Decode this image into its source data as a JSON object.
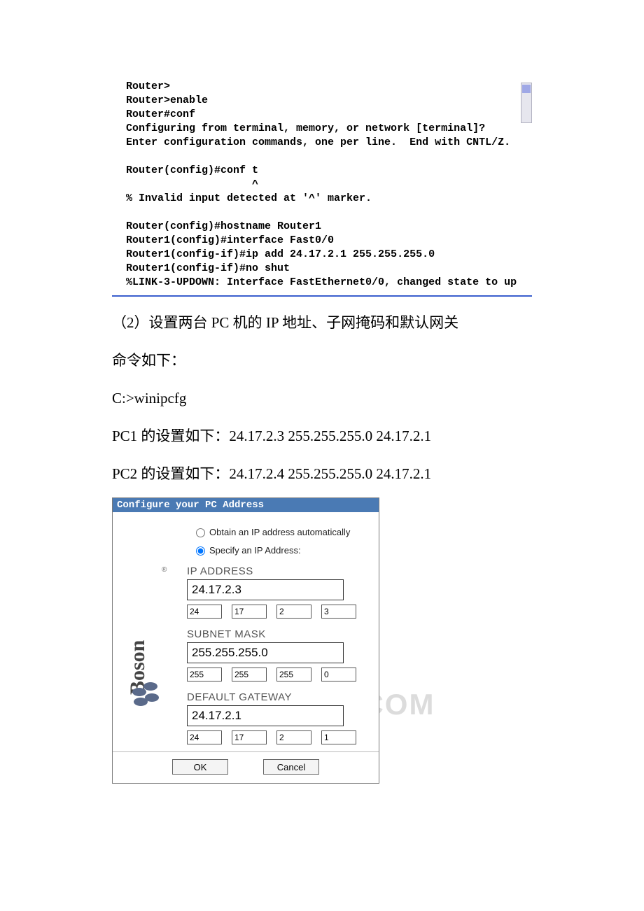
{
  "terminal_lines": "Router>\nRouter>enable\nRouter#conf\nConfiguring from terminal, memory, or network [terminal]?\nEnter configuration commands, one per line.  End with CNTL/Z.\n\nRouter(config)#conf t\n                    ^\n% Invalid input detected at '^' marker.\n\nRouter(config)#hostname Router1\nRouter1(config)#interface Fast0/0\nRouter1(config-if)#ip add 24.17.2.1 255.255.255.0\nRouter1(config-if)#no shut\n%LINK-3-UPDOWN: Interface FastEthernet0/0, changed state to up",
  "body": {
    "step2": "（2）设置两台 PC 机的 IP 地址、子网掩码和默认网关",
    "cmd_label": "命令如下：",
    "cmd": "C:>winipcfg",
    "pc1": "PC1 的设置如下：24.17.2.3 255.255.255.0 24.17.2.1",
    "pc2": "PC2 的设置如下：24.17.2.4 255.255.255.0 24.17.2.1"
  },
  "dialog": {
    "title": "Configure your PC Address",
    "radio_obtain": "Obtain an IP address automatically",
    "radio_specify": "Specify an IP Address:",
    "ip_label": "IP ADDRESS",
    "ip_value": "24.17.2.3",
    "ip_octets": [
      "24",
      "17",
      "2",
      "3"
    ],
    "mask_label": "SUBNET MASK",
    "mask_value": "255.255.255.0",
    "mask_octets": [
      "255",
      "255",
      "255",
      "0"
    ],
    "gw_label": "DEFAULT GATEWAY",
    "gw_value": "24.17.2.1",
    "gw_octets": [
      "24",
      "17",
      "2",
      "1"
    ],
    "ok": "OK",
    "cancel": "Cancel"
  },
  "watermark": "www.bdocx.COM",
  "logo_text": "Boson"
}
